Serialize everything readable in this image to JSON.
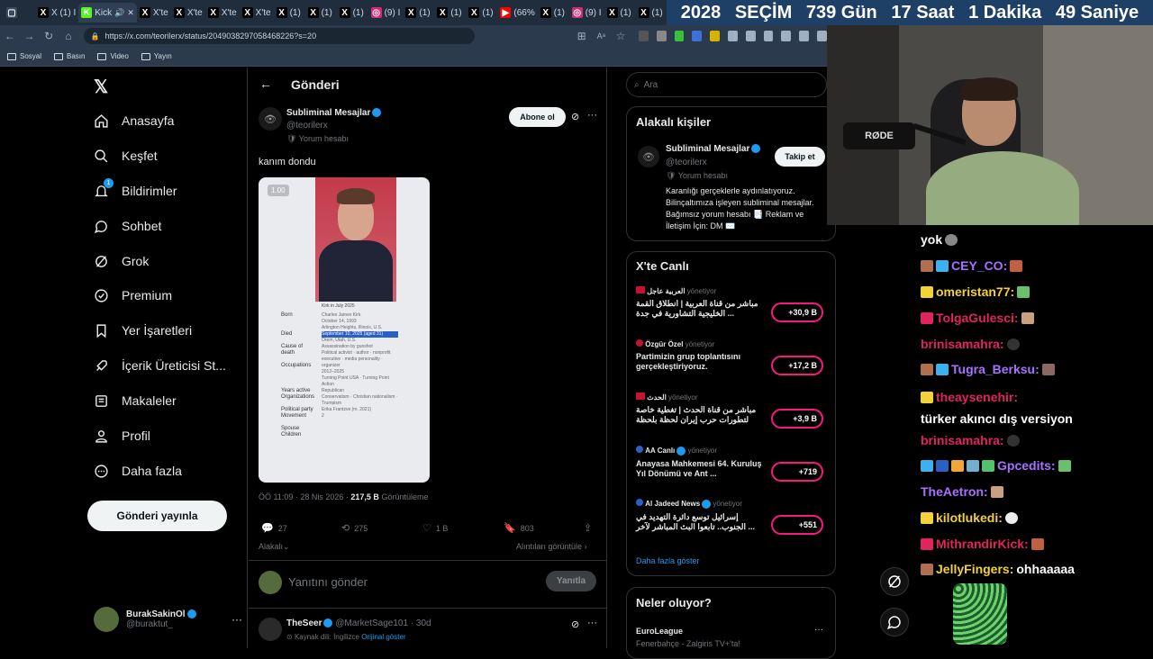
{
  "browser": {
    "tabs": [
      {
        "label": "",
        "icon": "window-icon"
      },
      {
        "label": "X (1) I",
        "icon": "x-icon"
      },
      {
        "label": "Kick",
        "icon": "kick-icon",
        "active": true
      },
      {
        "label": "X'te",
        "icon": "x-icon"
      },
      {
        "label": "X'te",
        "icon": "x-icon"
      },
      {
        "label": "X'te",
        "icon": "x-icon"
      },
      {
        "label": "X'te",
        "icon": "x-icon"
      },
      {
        "label": "(1)",
        "icon": "x-icon"
      },
      {
        "label": "(1)",
        "icon": "x-icon"
      },
      {
        "label": "(1)",
        "icon": "x-icon"
      },
      {
        "label": "(9) I",
        "icon": "instagram-icon"
      },
      {
        "label": "(1)",
        "icon": "x-icon"
      },
      {
        "label": "(1)",
        "icon": "x-icon"
      },
      {
        "label": "(1)",
        "icon": "x-icon"
      },
      {
        "label": "(66%",
        "icon": "youtube-icon"
      },
      {
        "label": "(1)",
        "icon": "x-icon"
      },
      {
        "label": "(9) I",
        "icon": "instagram-icon"
      },
      {
        "label": "(1)",
        "icon": "x-icon"
      },
      {
        "label": "(1)",
        "icon": "x-icon"
      }
    ],
    "url": "https://x.com/teorilerx/status/2049038297058468226?s=20",
    "bookmarks": [
      "Sosyal",
      "Basın",
      "Video",
      "Yayın"
    ]
  },
  "countdown": [
    "2028",
    "SEÇİM",
    "739 Gün",
    "17 Saat",
    "1 Dakika",
    "49 Saniye"
  ],
  "nav": {
    "items": [
      "Anasayfa",
      "Keşfet",
      "Bildirimler",
      "Sohbet",
      "Grok",
      "Premium",
      "Yer İşaretleri",
      "İçerik Üreticisi St...",
      "Makaleler",
      "Profil",
      "Daha fazla"
    ],
    "notif_badge": "1",
    "post_button": "Gönderi yayınla",
    "profile_name": "BurakSakinOl",
    "profile_handle": "@buraktut_",
    "more": "···"
  },
  "post": {
    "header_title": "Gönderi",
    "author_name": "Subliminal Mesajlar",
    "author_handle": "@teorilerx",
    "author_note": "Yorum hesabı",
    "follow_button": "Abone ol",
    "text": "kanım dondu",
    "image_badge": "1.00",
    "image_caption": "Kirk in July 2025",
    "info_labels": [
      "Born",
      "Died",
      "Cause of death",
      "Occupations",
      "Years active",
      "Organizations",
      "Political party",
      "Movement",
      "Spouse",
      "Children"
    ],
    "info_values": [
      "Charles James Kirk",
      "October 14, 1993",
      "Arlington Heights, Illinois, U.S.",
      "September 10, 2025 (aged 31)",
      "Orem, Utah, U.S.",
      "Assassination by gunshot",
      "Political activist · author · nonprofit executive · media personality · organizer",
      "2012–2025",
      "Turning Point USA · Turning Point Action",
      "Republican",
      "Conservatism · Christian nationalism · Trumpism",
      "Erika Frantzve (m. 2021)",
      "2"
    ],
    "time": "ÖÖ 11:09 · 28 Nis 2026 ·",
    "views": "217,5 B",
    "views_label": "Görüntüleme",
    "replies": "27",
    "reposts": "275",
    "likes": "1 B",
    "bookmarks": "803",
    "relevant": "Alakalı",
    "quotes_link": "Alıntıları görüntüle",
    "reply_placeholder": "Yanıtını gönder",
    "reply_button": "Yanıtla",
    "reply_author": "TheSeer",
    "reply_handle": "@MarketSage101 · 30d",
    "reply_source": "Kaynak dili: İngilizce",
    "reply_original": "Orijinal göster"
  },
  "right": {
    "search_placeholder": "Ara",
    "related_title": "Alakalı kişiler",
    "related_name": "Subliminal Mesajlar",
    "related_handle": "@teorilerx",
    "related_note": "Yorum hesabı",
    "related_follow": "Takip et",
    "related_bio": "Karanlığı gerçeklerle aydınlatıyoruz. Bilinçaltımıza işleyen subliminal mesajlar. Bağımsız yorum hesabı 📑 Reklam ve İletişim İçin: DM ✉️",
    "live_title": "X'te Canlı",
    "live_items": [
      {
        "host": "العربية عاجل",
        "role": "yönetiyor",
        "title": "مباشر من قناة العربية | انطلاق القمة الخليجية التشاورية في جدة ...",
        "count": "+30,9 B"
      },
      {
        "host": "Özgür Özel",
        "role": "yönetiyor",
        "title": "Partimizin grup toplantısını gerçekleştiriyoruz.",
        "count": "+17,2 B"
      },
      {
        "host": "الحدث",
        "role": "yönetiyor",
        "title": "مباشر من قناة الحدث | تغطية خاصة لتطورات حرب إيران لحظة بلحظة",
        "count": "+3,9 B"
      },
      {
        "host": "AA Canlı",
        "role": "yönetiyor",
        "title": "Anayasa Mahkemesi 64. Kuruluş Yıl Dönümü ve Ant ...",
        "count": "+719"
      },
      {
        "host": "Al Jadeed News",
        "role": "yönetiyor",
        "title": "إسرائيل توسع دائرة التهديد في الجنوب.. تابعوا البث المباشر لآخر ...",
        "count": "+551"
      }
    ],
    "show_more": "Daha fazla göster",
    "whats_happening": "Neler oluyor?",
    "trend_name": "EuroLeague",
    "trend_sub": "Fenerbahçe - Zalgiris TV+'ta!"
  },
  "webcam": {
    "mic_brand": "RØDE"
  },
  "chat": [
    {
      "user": "",
      "text": "yok",
      "color": "#ffffff"
    },
    {
      "user": "CEY_CO:",
      "text": "",
      "color": "#a970ff"
    },
    {
      "user": "omeristan77:",
      "text": "",
      "color": "#f2d13a"
    },
    {
      "user": "TolgaGulesci:",
      "text": "",
      "color": "#e0245e"
    },
    {
      "user": "brinisamahra:",
      "text": "",
      "color": "#e0245e"
    },
    {
      "user": "Tugra_Berksu:",
      "text": "",
      "color": "#a970ff"
    },
    {
      "user": "theaysenehir:",
      "text": "türker akıncı dış versiyon",
      "color": "#e0245e"
    },
    {
      "user": "brinisamahra:",
      "text": "",
      "color": "#e0245e"
    },
    {
      "user": "Gpcedits:",
      "text": "",
      "color": "#a970ff"
    },
    {
      "user": "TheAetron:",
      "text": "",
      "color": "#a970ff"
    },
    {
      "user": "kilotlukedi:",
      "text": "",
      "color": "#f2d13a"
    },
    {
      "user": "MithrandirKick:",
      "text": "",
      "color": "#e0245e"
    },
    {
      "user": "JellyFingers:",
      "text": "ohhaaaaa",
      "color": "#f2d13a"
    }
  ],
  "colors": {
    "accent": "#1d9bf0",
    "live_pink": "#f91880",
    "countdown_bg": "#1e3f66"
  }
}
